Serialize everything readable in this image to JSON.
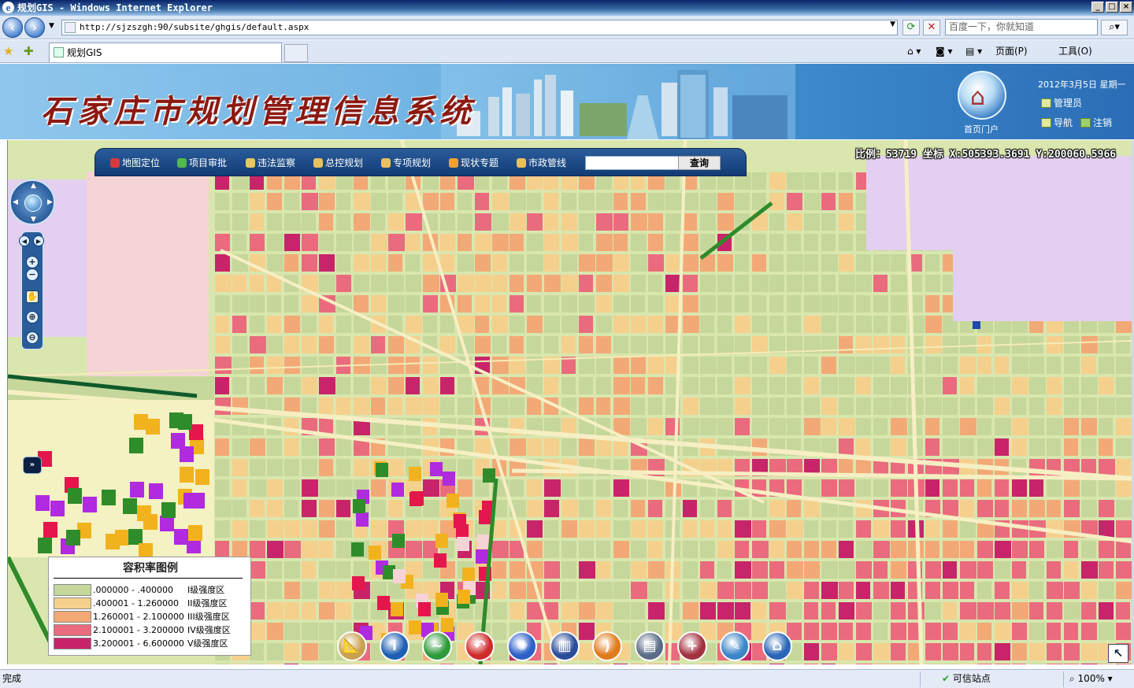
{
  "window": {
    "title": "规划GIS - Windows Internet Explorer",
    "min": "_",
    "max": "□",
    "close": "×"
  },
  "browser": {
    "back": "‹",
    "forward": "›",
    "url": "http://sjzszgh:90/subsite/ghgis/default.aspx",
    "search_placeholder": "百度一下，你就知道",
    "tab_title": "规划GIS",
    "tools": {
      "page": "页面(P)",
      "tools": "工具(O)"
    }
  },
  "app": {
    "title": "石家庄市规划管理信息系统",
    "home_label": "首页门户",
    "date": "2012年3月5日 星期一",
    "user": "管理员",
    "nav": "导航",
    "logout": "注销"
  },
  "map": {
    "toolbar": [
      {
        "label": "地图定位",
        "color": "#d8393d"
      },
      {
        "label": "项目审批",
        "color": "#52b84c"
      },
      {
        "label": "违法监察",
        "color": "#e8c860"
      },
      {
        "label": "总控规划",
        "color": "#e8c060"
      },
      {
        "label": "专项规划",
        "color": "#e8c060"
      },
      {
        "label": "现状专题",
        "color": "#f0a030"
      },
      {
        "label": "市政管线",
        "color": "#e8c060"
      }
    ],
    "query_button": "查询",
    "coords": "比例：53719 坐标 X:505393.3691 Y:200060.5966",
    "legend": {
      "title": "容积率图例",
      "rows": [
        {
          "range": ".000000 - .400000",
          "level": "I级强度区",
          "color": "#c5d79a"
        },
        {
          "range": ".400001 - 1.260000",
          "level": "II级强度区",
          "color": "#f5d08c"
        },
        {
          "range": "1.260001 - 2.100000",
          "level": "III级强度区",
          "color": "#f3a976"
        },
        {
          "range": "2.100001 - 3.200000",
          "level": "IV级强度区",
          "color": "#ea6b7e"
        },
        {
          "range": "3.200001 - 6.600000",
          "level": "V级强度区",
          "color": "#c8246a"
        }
      ]
    },
    "dock": [
      {
        "name": "ruler-icon",
        "glyph": "📐",
        "bg": "#c8a050"
      },
      {
        "name": "info-icon",
        "glyph": "i",
        "bg": "#1d5fb3"
      },
      {
        "name": "chart-icon",
        "glyph": "~",
        "bg": "#2e9a3a"
      },
      {
        "name": "back-icon",
        "glyph": "↶",
        "bg": "#cf2b2b"
      },
      {
        "name": "network-icon",
        "glyph": "✺",
        "bg": "#2c5fc7"
      },
      {
        "name": "layers-icon",
        "glyph": "▥",
        "bg": "#2a4c9a"
      },
      {
        "name": "rss-icon",
        "glyph": ")",
        "bg": "#e07a1c"
      },
      {
        "name": "print-icon",
        "glyph": "▤",
        "bg": "#5a6c86"
      },
      {
        "name": "bookmark-add-icon",
        "glyph": "+",
        "bg": "#a23240"
      },
      {
        "name": "edit-icon",
        "glyph": "✎",
        "bg": "#3c86c8"
      },
      {
        "name": "home-icon",
        "glyph": "⌂",
        "bg": "#2a66b8"
      }
    ],
    "fast_forward": "»",
    "expand": "↖"
  },
  "status": {
    "text": "完成",
    "zone": "可信站点",
    "zoom": "100%"
  }
}
